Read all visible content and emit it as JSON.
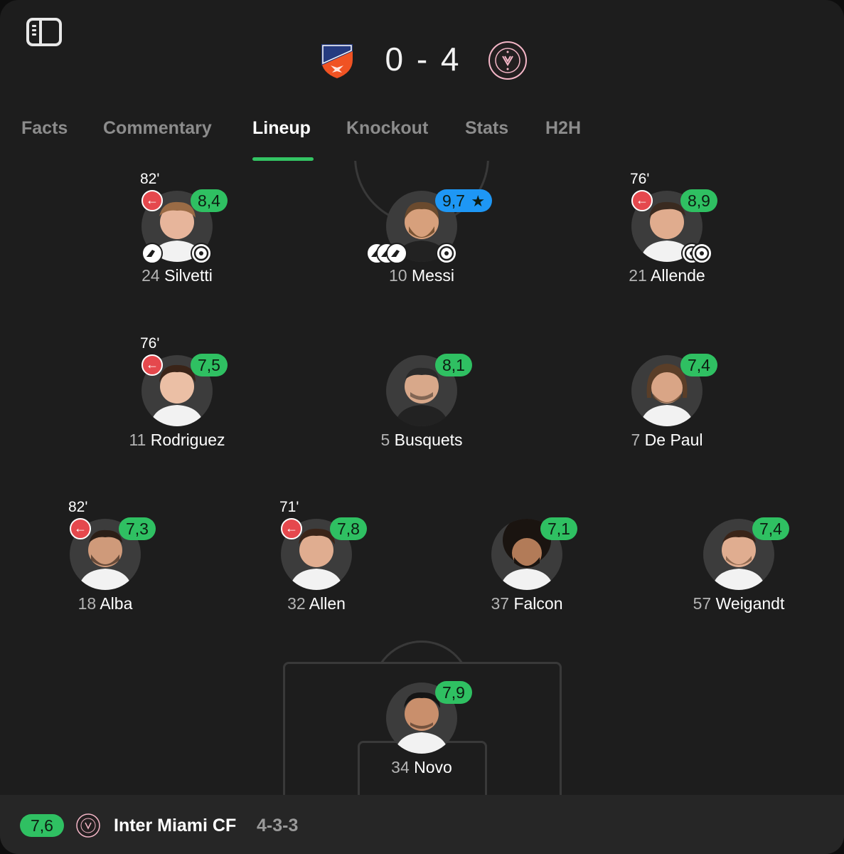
{
  "header": {
    "score": "0 - 4",
    "home_team_icon": "fc-cincinnati-crest-icon",
    "away_team_icon": "inter-miami-crest-icon",
    "home_crest_text": "FC CINCINNATI",
    "away_crest_text": "CLUB INTERNACIONAL DE FÚTBOL MIAMI MMXVIII"
  },
  "tabs": [
    {
      "label": "Facts"
    },
    {
      "label": "Commentary"
    },
    {
      "label": "Lineup",
      "active": true
    },
    {
      "label": "Knockout"
    },
    {
      "label": "Stats"
    },
    {
      "label": "H2H"
    }
  ],
  "players": [
    {
      "number": "24",
      "name": "Silvetti",
      "rating": "8,4",
      "sub_minute": "82'",
      "events": [
        "assist-boot-icon",
        "goal-ball-icon"
      ]
    },
    {
      "number": "10",
      "name": "Messi",
      "rating": "9,7",
      "top_rated": true,
      "events": [
        "assist-boot-icon",
        "assist-boot-icon",
        "assist-boot-icon",
        "goal-ball-icon"
      ]
    },
    {
      "number": "21",
      "name": "Allende",
      "rating": "8,9",
      "sub_minute": "76'",
      "events": [
        "goal-ball-icon",
        "goal-ball-icon"
      ]
    },
    {
      "number": "11",
      "name": "Rodriguez",
      "rating": "7,5",
      "sub_minute": "76'"
    },
    {
      "number": "5",
      "name": "Busquets",
      "rating": "8,1"
    },
    {
      "number": "7",
      "name": "De Paul",
      "rating": "7,4"
    },
    {
      "number": "18",
      "name": "Alba",
      "rating": "7,3",
      "sub_minute": "82'"
    },
    {
      "number": "32",
      "name": "Allen",
      "rating": "7,8",
      "sub_minute": "71'"
    },
    {
      "number": "37",
      "name": "Falcon",
      "rating": "7,1"
    },
    {
      "number": "57",
      "name": "Weigandt",
      "rating": "7,4"
    },
    {
      "number": "34",
      "name": "Novo",
      "rating": "7,9"
    }
  ],
  "footer": {
    "team_rating": "7,6",
    "team_name": "Inter Miami CF",
    "formation": "4-3-3",
    "crest_icon": "inter-miami-crest-icon"
  },
  "colors": {
    "rating_green": "#2fc062",
    "top_rated_blue": "#1e97f5",
    "sub_off_red": "#e5484d",
    "tab_underline": "#33c463",
    "background": "#1d1d1d"
  }
}
